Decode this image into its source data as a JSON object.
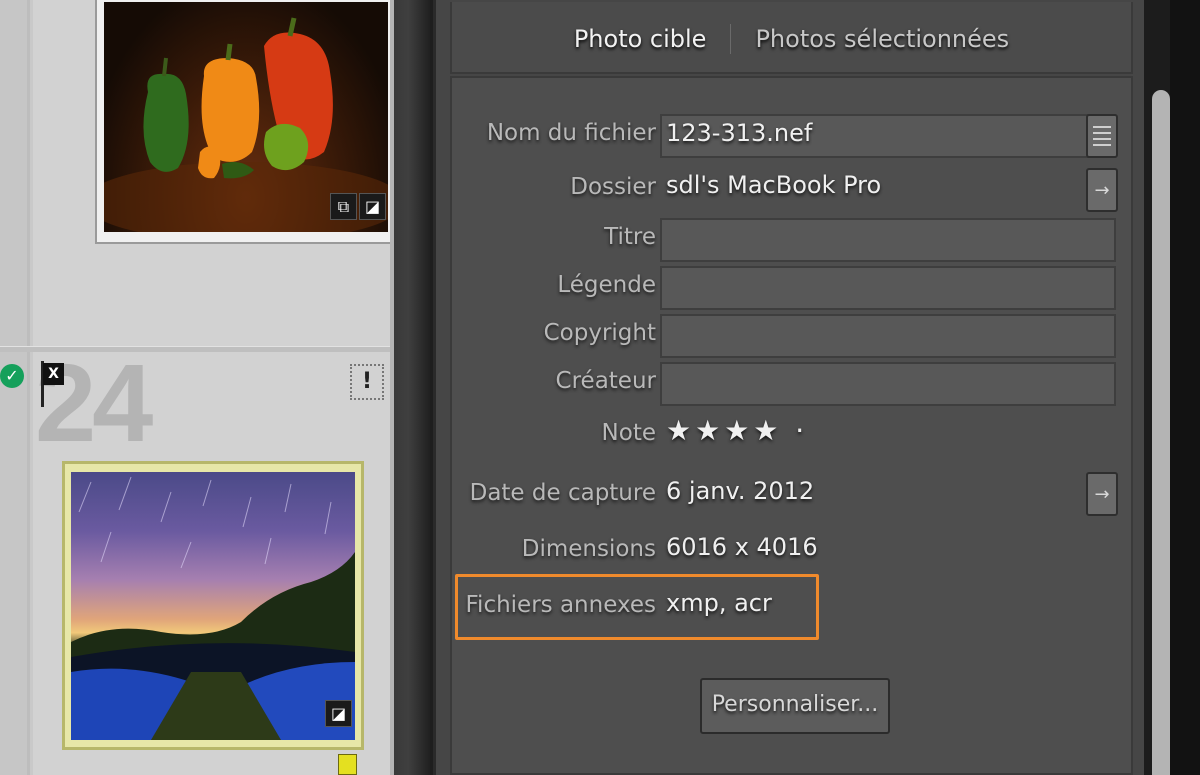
{
  "grid": {
    "cell_number": "24",
    "flag_label": "X",
    "warning_label": "!",
    "check_icon": "check-circle-icon",
    "colors": {
      "selected_frame": "#e7e7a8",
      "label_yellow": "#e4e020",
      "check_green": "#15a05b"
    }
  },
  "panel": {
    "tabs": [
      {
        "label": "Photo cible",
        "active": true
      },
      {
        "label": "Photos sélectionnées",
        "active": false
      }
    ],
    "metadata": {
      "filename": {
        "label": "Nom du fichier",
        "value": "123-313.nef"
      },
      "folder": {
        "label": "Dossier",
        "value": "sdl's MacBook Pro"
      },
      "title": {
        "label": "Titre",
        "value": ""
      },
      "caption": {
        "label": "Légende",
        "value": ""
      },
      "copyright": {
        "label": "Copyright",
        "value": ""
      },
      "creator": {
        "label": "Créateur",
        "value": ""
      },
      "rating": {
        "label": "Note",
        "value": "★★★★ ·",
        "stars": 4
      },
      "capture_date": {
        "label": "Date de capture",
        "value": "6 janv. 2012"
      },
      "dimensions": {
        "label": "Dimensions",
        "value": "6016 x 4016"
      },
      "sidecar": {
        "label": "Fichiers annexes",
        "value": "xmp, acr"
      }
    },
    "customize_button": "Personnaliser...",
    "highlight_color": "#f08a2c"
  }
}
